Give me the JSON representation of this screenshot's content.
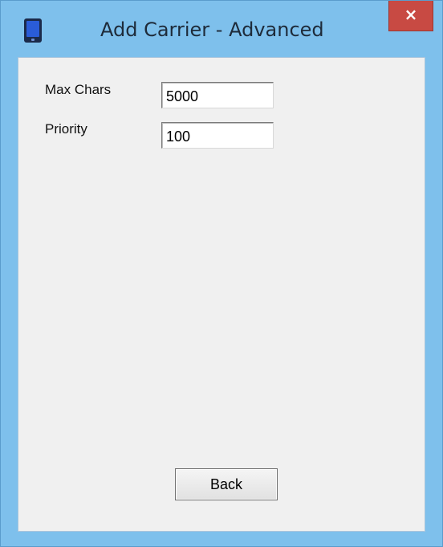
{
  "window": {
    "title": "Add Carrier - Advanced",
    "app_icon": "phone-icon",
    "close_glyph": "×",
    "close_icon": "close-icon"
  },
  "form": {
    "max_chars": {
      "label": "Max Chars",
      "value": "5000"
    },
    "priority": {
      "label": "Priority",
      "value": "100"
    }
  },
  "actions": {
    "back_label": "Back"
  },
  "colors": {
    "frame": "#7ec0ec",
    "close_button": "#c84a43",
    "client_background": "#f0f0f0"
  }
}
